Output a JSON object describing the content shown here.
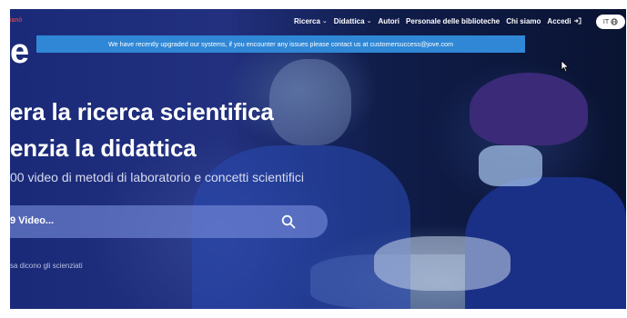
{
  "header": {
    "tagline": "ianò",
    "logo_letter": "e",
    "nav": [
      {
        "label": "Ricerca",
        "has_dropdown": true
      },
      {
        "label": "Didattica",
        "has_dropdown": true
      },
      {
        "label": "Autori",
        "has_dropdown": false
      },
      {
        "label": "Personale delle biblioteche",
        "has_dropdown": false
      },
      {
        "label": "Chi siamo",
        "has_dropdown": false
      },
      {
        "label": "Accedi",
        "has_dropdown": false,
        "icon": "login-icon"
      }
    ],
    "language": "IT",
    "language_icon": "globe-icon"
  },
  "banner": {
    "text": "We have recently upgraded our systems, if you encounter any issues please contact us at  customersuccess@jove.com"
  },
  "hero": {
    "headline_line1": "era la ricerca scientifica",
    "headline_line2": "enzia la didattica",
    "subheadline": "00 video di metodi di laboratorio e concetti scientifici",
    "search_placeholder": "9 Video...",
    "search_icon": "search-icon",
    "testimonials_link": "sa dicono gli scienziati"
  },
  "colors": {
    "banner_bg": "#2f87d6",
    "hero_bg": "#1a2a78",
    "tagline": "#ff4d4d"
  }
}
